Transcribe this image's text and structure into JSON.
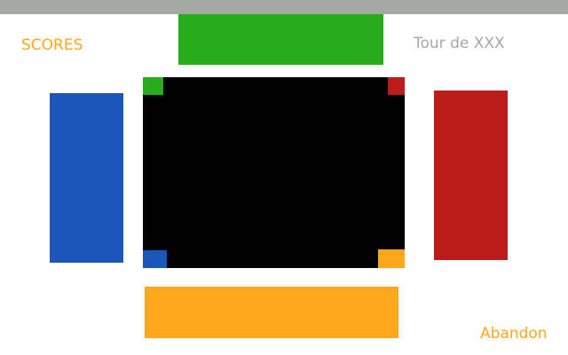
{
  "header": {
    "scores_label": "SCORES",
    "turn_label": "Tour de XXX"
  },
  "footer": {
    "abandon_label": "Abandon"
  },
  "colors": {
    "top_bar": "#a5a8a5",
    "green_player": "#29ab1c",
    "blue_player": "#1b56bb",
    "red_player": "#bb1b1b",
    "orange_player": "#ffa61c",
    "board": "#000000"
  },
  "players": [
    {
      "position": "top",
      "color": "#29ab1c"
    },
    {
      "position": "left",
      "color": "#1b56bb"
    },
    {
      "position": "right",
      "color": "#bb1b1b"
    },
    {
      "position": "bottom",
      "color": "#ffa61c"
    }
  ]
}
